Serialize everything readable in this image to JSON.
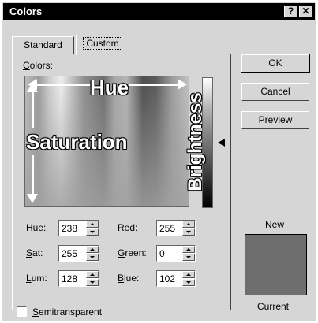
{
  "window": {
    "title": "Colors",
    "help_glyph": "?",
    "close_glyph": "✕"
  },
  "tabs": [
    {
      "label": "Standard",
      "active": false
    },
    {
      "label": "Custom",
      "active": true
    }
  ],
  "colors_label_prefix": "C",
  "colors_label_rest": "olors:",
  "spectrum_annotations": {
    "hue": "Hue",
    "saturation": "Saturation",
    "brightness": "Brightness"
  },
  "fields": {
    "hue": {
      "label_u": "H",
      "label_rest": "ue:",
      "value": "238"
    },
    "sat": {
      "label_u": "S",
      "label_rest": "at:",
      "value": "255"
    },
    "lum": {
      "label_u": "L",
      "label_rest": "um:",
      "value": "128"
    },
    "red": {
      "label_u": "R",
      "label_rest": "ed:",
      "value": "255"
    },
    "green": {
      "label_u": "G",
      "label_rest": "reen:",
      "value": "0"
    },
    "blue": {
      "label_u": "B",
      "label_rest": "lue:",
      "value": "102"
    }
  },
  "buttons": {
    "ok": "OK",
    "cancel": "Cancel",
    "preview_u": "P",
    "preview_rest": "review"
  },
  "preview": {
    "new_label": "New",
    "current_label": "Current",
    "swatch_color": "#6e6e6e"
  },
  "semitransparent": {
    "label_u": "S",
    "label_rest": "emitransparent",
    "checked": false
  }
}
